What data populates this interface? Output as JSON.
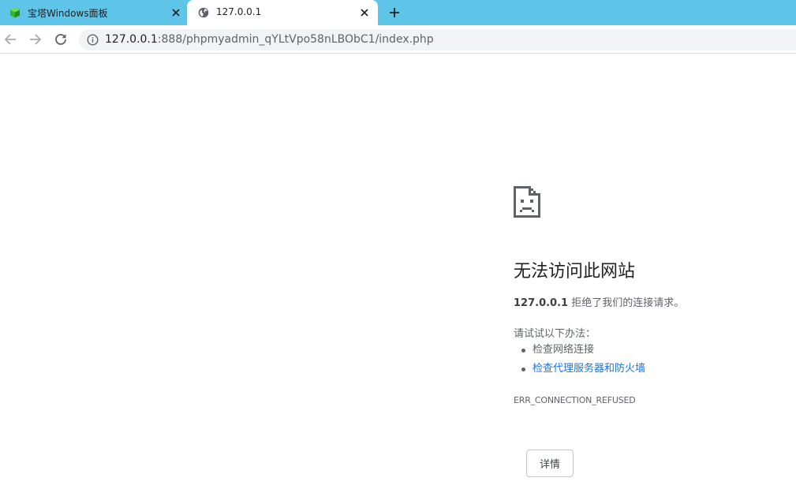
{
  "colors": {
    "tabstrip_bg": "#5ec5e8",
    "omnibox_bg": "#f1f3f4",
    "link": "#1a73e8",
    "favicon_green": "#2eb82e"
  },
  "tabs": [
    {
      "title": "宝塔Windows面板",
      "favicon": "bt-panel-cube-icon",
      "active": false
    },
    {
      "title": "127.0.0.1",
      "favicon": "globe-icon",
      "active": true
    }
  ],
  "toolbar": {
    "url_host": "127.0.0.1",
    "url_rest": ":888/phpmyadmin_qYLtVpo58nLBObC1/index.php"
  },
  "error": {
    "heading": "无法访问此网站",
    "host": "127.0.0.1",
    "message": " 拒绝了我们的连接请求。",
    "suggest_title": "请试试以下办法：",
    "suggestions": [
      {
        "text": "检查网络连接",
        "link": false
      },
      {
        "text": "检查代理服务器和防火墙",
        "link": true
      }
    ],
    "code": "ERR_CONNECTION_REFUSED",
    "details_label": "详情"
  }
}
